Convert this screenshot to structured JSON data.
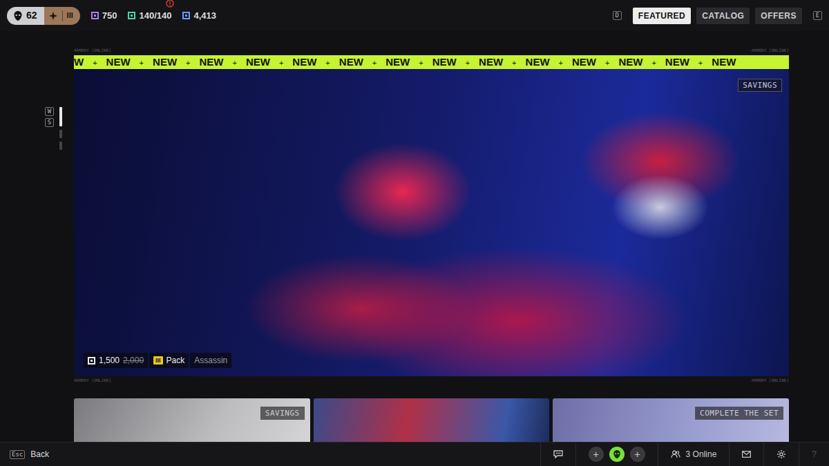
{
  "topbar": {
    "level": "62",
    "badge": "III",
    "currencies": [
      {
        "value": "750",
        "color": "#b07cf0",
        "alert": false
      },
      {
        "value": "140/140",
        "color": "#4fd1a0",
        "alert": true
      },
      {
        "value": "4,413",
        "color": "#6a9cff",
        "alert": false
      }
    ]
  },
  "nav": {
    "prev_key": "D",
    "next_key": "E",
    "tabs": [
      {
        "label": "FEATURED",
        "selected": true
      },
      {
        "label": "CATALOG",
        "selected": false
      },
      {
        "label": "OFFERS",
        "selected": false
      }
    ]
  },
  "pager": {
    "up_key": "W",
    "down_key": "S",
    "pages": [
      {
        "selected": true
      },
      {
        "selected": false
      },
      {
        "selected": false
      }
    ]
  },
  "banner": {
    "labels_top": [
      "ARMORY [ONLINE]",
      "ARMORY [ONLINE]"
    ],
    "labels_bottom": [
      "ARMORY [ONLINE]",
      "ARMORY [ONLINE]"
    ],
    "ticker": [
      "W",
      "NEW",
      "NEW",
      "NEW",
      "NEW",
      "NEW",
      "NEW",
      "NEW",
      "NEW",
      "NEW",
      "NEW",
      "NEW",
      "NEW",
      "NEW",
      "NEW"
    ],
    "ticker_separator": "+",
    "tag": "SAVINGS",
    "price": "1,500",
    "old_price": "2,000",
    "pack_badge": "III",
    "type": "Pack",
    "name": "Assassin"
  },
  "cards": [
    {
      "tag": "SAVINGS"
    },
    {
      "tag": null
    },
    {
      "tag": "COMPLETE THE SET"
    }
  ],
  "bottom": {
    "back_key": "Esc",
    "back_label": "Back",
    "invite_slots": [
      "+",
      "+"
    ],
    "online": "3 Online",
    "help": "?"
  }
}
